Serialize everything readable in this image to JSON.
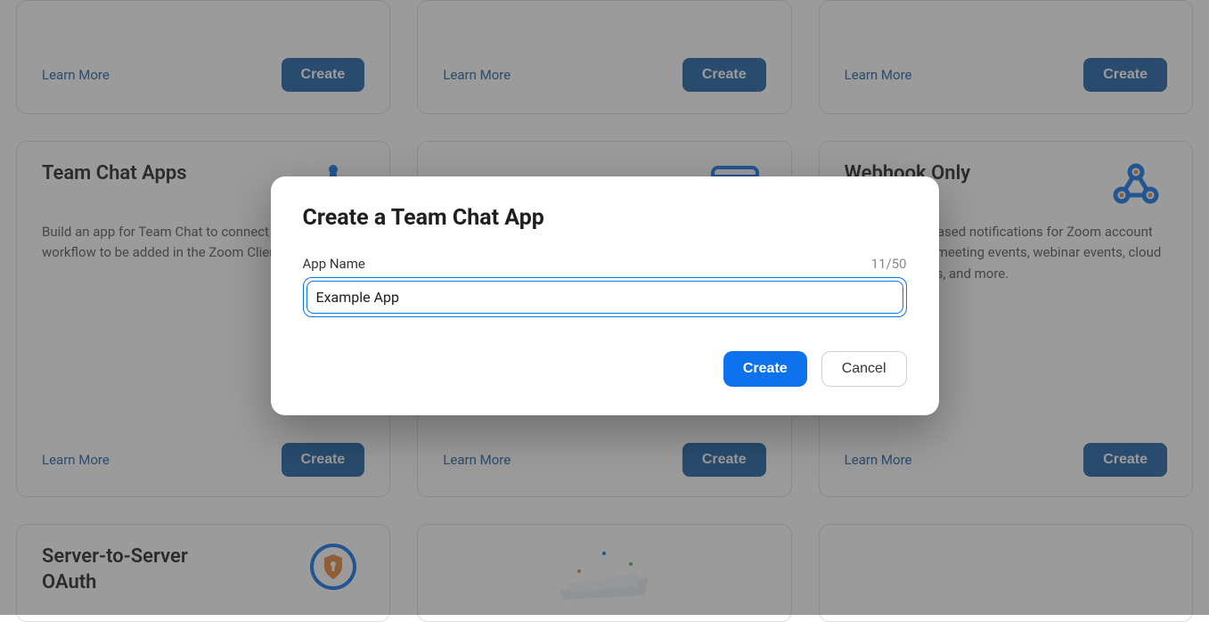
{
  "cards": {
    "row1": [
      {
        "learn_more": "Learn More",
        "create": "Create"
      },
      {
        "learn_more": "Learn More",
        "create": "Create"
      },
      {
        "learn_more": "Learn More",
        "create": "Create"
      }
    ],
    "row2": [
      {
        "title": "Team Chat Apps",
        "desc": "Build an app for Team Chat to connect data or a workflow to be added in the Zoom Client.",
        "learn_more": "Learn More",
        "create": "Create"
      },
      {
        "title": "",
        "desc": "",
        "learn_more": "Learn More",
        "create": "Create"
      },
      {
        "title": "Webhook Only",
        "desc": "Receive event-based notifications for Zoom account events such as meeting events, webinar events, cloud recording events, and more.",
        "learn_more": "Learn More",
        "create": "Create"
      }
    ],
    "row3": [
      {
        "title": "Server-to-Server OAuth"
      }
    ]
  },
  "modal": {
    "title": "Create a Team Chat App",
    "field_label": "App Name",
    "char_count": "11/50",
    "input_value": "Example App",
    "create_label": "Create",
    "cancel_label": "Cancel"
  }
}
